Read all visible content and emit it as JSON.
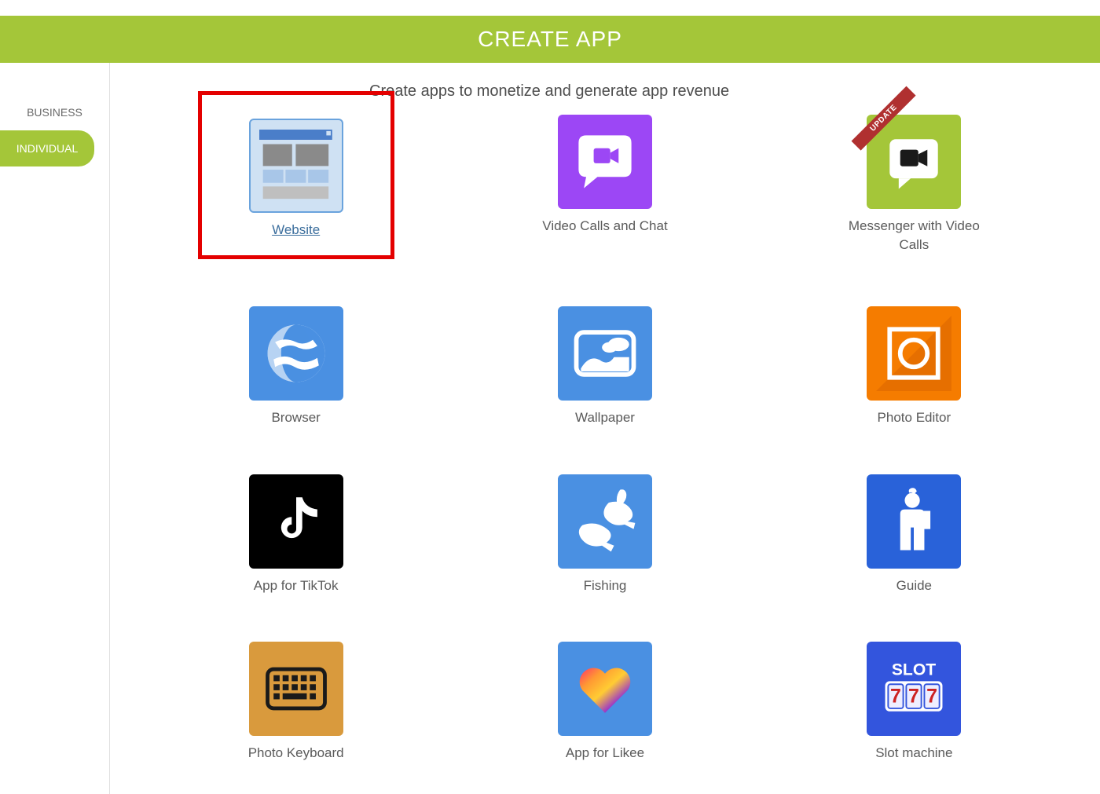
{
  "header": {
    "title": "CREATE APP"
  },
  "sidebar": {
    "items": [
      {
        "label": "BUSINESS"
      },
      {
        "label": "INDIVIDUAL"
      }
    ]
  },
  "main": {
    "subtitle": "Create apps to monetize and generate app revenue",
    "apps": [
      {
        "label": "Website"
      },
      {
        "label": "Video Calls and Chat"
      },
      {
        "label": "Messenger with Video Calls",
        "ribbon": "UPDATE"
      },
      {
        "label": "Browser"
      },
      {
        "label": "Wallpaper"
      },
      {
        "label": "Photo Editor"
      },
      {
        "label": "App for TikTok"
      },
      {
        "label": "Fishing"
      },
      {
        "label": "Guide"
      },
      {
        "label": "Photo Keyboard"
      },
      {
        "label": "App for Likee"
      },
      {
        "label": "Slot machine"
      }
    ]
  }
}
